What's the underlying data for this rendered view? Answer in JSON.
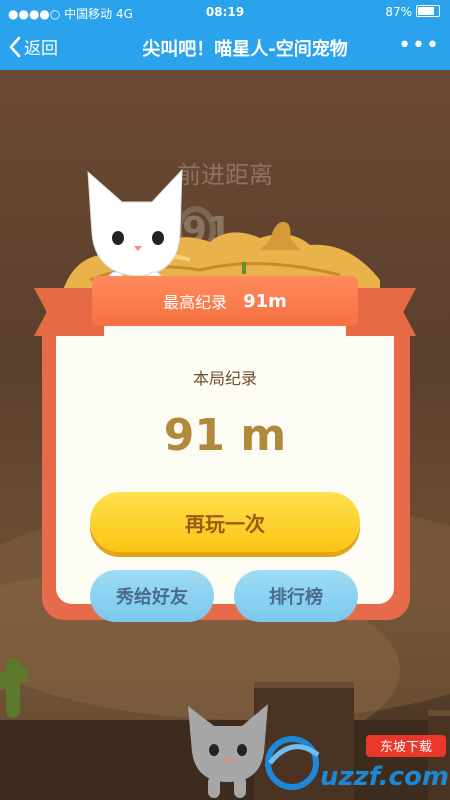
{
  "status_bar": {
    "carrier": "●●●●○ 中国移动  4G",
    "time": "08:19",
    "battery": "87%"
  },
  "nav": {
    "back_label": "返回",
    "title": "尖叫吧！喵星人-空间宠物",
    "more_label": "•••"
  },
  "game": {
    "distance_label": "前进距离",
    "distance_value": "91",
    "best_record_label": "最高纪录",
    "best_record_value": "91m",
    "round_record_label": "本局纪录",
    "round_record_value": "91 m",
    "play_again_label": "再玩一次",
    "share_label": "秀给好友",
    "leaderboard_label": "排行榜"
  },
  "watermark": {
    "site": "uzzf.com",
    "brand": "东坡下载"
  },
  "colors": {
    "nav_blue": "#2aa3ec",
    "ribbon_orange": "#f57042",
    "button_yellow": "#f9c515",
    "button_blue": "#7bc8ec"
  }
}
